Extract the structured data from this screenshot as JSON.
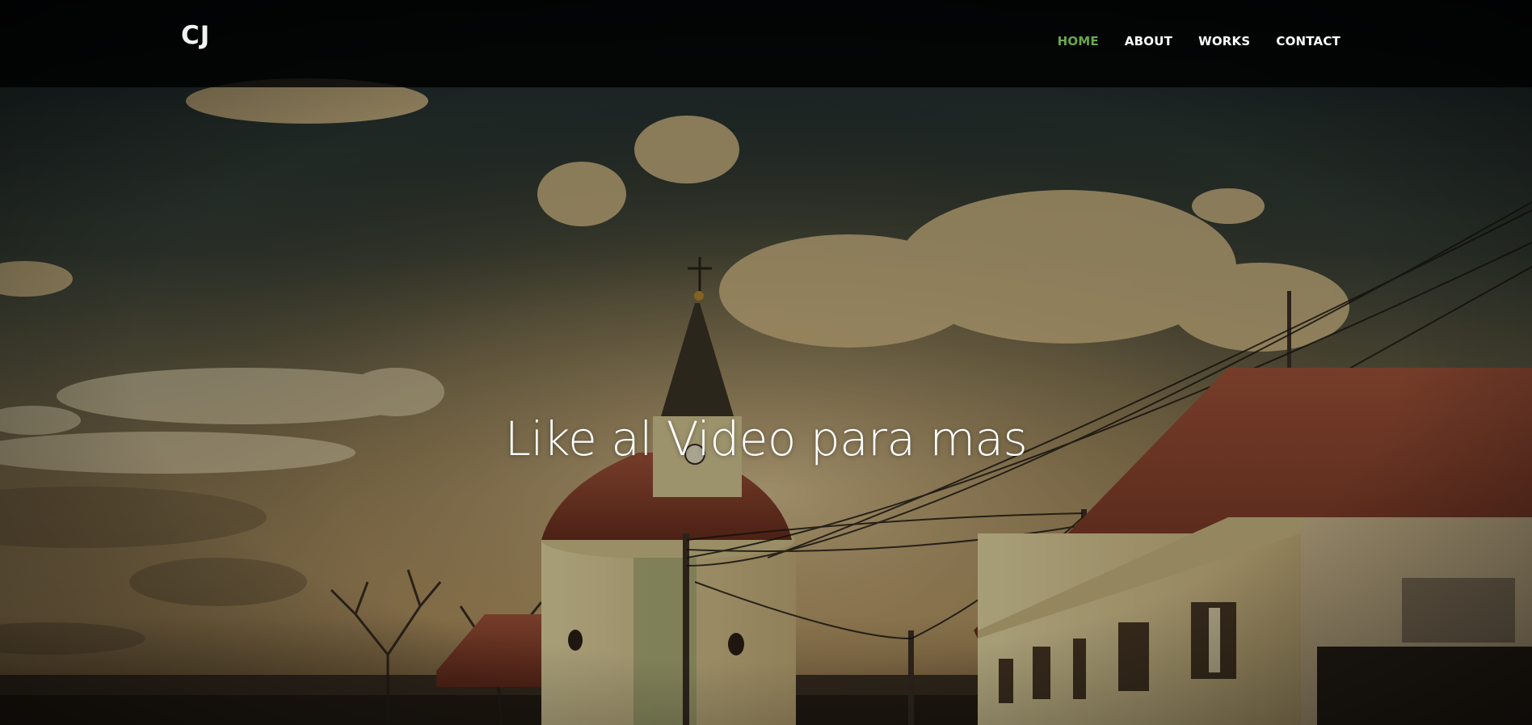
{
  "brand": {
    "logo_text": "CJ"
  },
  "nav": {
    "items": [
      {
        "label": "HOME",
        "active": true
      },
      {
        "label": "ABOUT",
        "active": false
      },
      {
        "label": "WORKS",
        "active": false
      },
      {
        "label": "CONTACT",
        "active": false
      }
    ]
  },
  "hero": {
    "headline": "Like al Video para mas",
    "image_description": "village church with steeple, old houses and power lines under a dramatic cloudy sky"
  },
  "colors": {
    "nav_active": "#6aa84f",
    "nav_text": "#ffffff",
    "navbar_bg": "#0b0b0b"
  }
}
